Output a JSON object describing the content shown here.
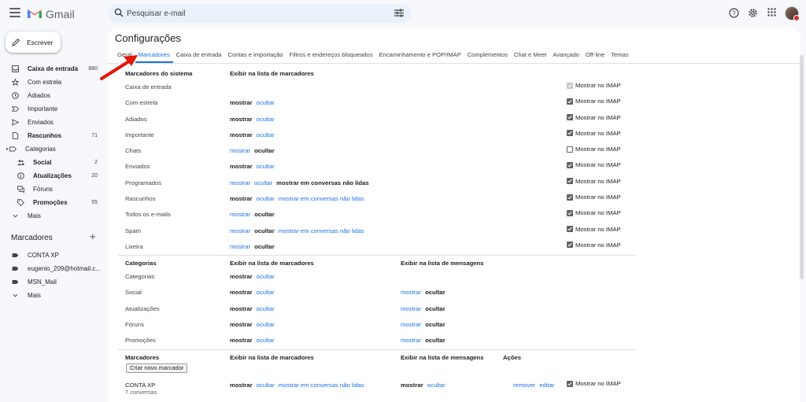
{
  "app": {
    "brand": "Gmail",
    "search_placeholder": "Pesquisar e-mail"
  },
  "compose": {
    "label": "Escrever"
  },
  "nav": {
    "items": [
      {
        "label": "Caixa de entrada",
        "count": "880",
        "bold": true,
        "icon": "inbox-icon"
      },
      {
        "label": "Com estrela",
        "count": "",
        "bold": false,
        "icon": "star-icon"
      },
      {
        "label": "Adiados",
        "count": "",
        "bold": false,
        "icon": "clock-icon"
      },
      {
        "label": "Importante",
        "count": "",
        "bold": false,
        "icon": "important-icon"
      },
      {
        "label": "Enviados",
        "count": "",
        "bold": false,
        "icon": "send-icon"
      },
      {
        "label": "Rascunhos",
        "count": "71",
        "bold": true,
        "icon": "draft-icon"
      },
      {
        "label": "Categorias",
        "count": "",
        "bold": false,
        "icon": "label-icon"
      },
      {
        "label": "Social",
        "count": "2",
        "bold": true,
        "icon": "people-icon"
      },
      {
        "label": "Atualizações",
        "count": "20",
        "bold": true,
        "icon": "info-icon"
      },
      {
        "label": "Fóruns",
        "count": "",
        "bold": false,
        "icon": "forum-icon"
      },
      {
        "label": "Promoções",
        "count": "55",
        "bold": true,
        "icon": "tag-icon"
      },
      {
        "label": "Mais",
        "count": "",
        "bold": false,
        "icon": "chevron-down-icon"
      }
    ],
    "labels_heading": "Marcadores",
    "labels": [
      "CONTA XP",
      "eugenio_209@hotmail.c...",
      "MSN_Mail",
      "Mais"
    ]
  },
  "settings": {
    "title": "Configurações",
    "tabs": [
      "Geral",
      "Marcadores",
      "Caixa de entrada",
      "Contas e importação",
      "Filtros e endereços bloqueados",
      "Encaminhamento e POP/IMAP",
      "Complementos",
      "Chat e Meet",
      "Avançado",
      "Off-line",
      "Temas"
    ],
    "active_tab": "Marcadores",
    "system": {
      "h1": "Marcadores do sistema",
      "h2": "Exibir na lista de marcadores",
      "rows": [
        {
          "name": "Caixa de entrada",
          "show": "",
          "hide": "",
          "unread": "",
          "active": "",
          "imap": "Mostrar no IMAP",
          "imap_state": "disabled"
        },
        {
          "name": "Com estrela",
          "show": "mostrar",
          "hide": "ocultar",
          "unread": "",
          "active": "show",
          "imap": "Mostrar no IMAP",
          "imap_state": "on"
        },
        {
          "name": "Adiados",
          "show": "mostrar",
          "hide": "ocultar",
          "unread": "",
          "active": "show",
          "imap": "Mostrar no IMAP",
          "imap_state": "on"
        },
        {
          "name": "Importante",
          "show": "mostrar",
          "hide": "ocultar",
          "unread": "",
          "active": "show",
          "imap": "Mostrar no IMAP",
          "imap_state": "on"
        },
        {
          "name": "Chats",
          "show": "mostrar",
          "hide": "ocultar",
          "unread": "",
          "active": "hide",
          "imap": "Mostrar no IMAP",
          "imap_state": "off"
        },
        {
          "name": "Enviados",
          "show": "mostrar",
          "hide": "ocultar",
          "unread": "",
          "active": "show",
          "imap": "Mostrar no IMAP",
          "imap_state": "on"
        },
        {
          "name": "Programados",
          "show": "mostrar",
          "hide": "ocultar",
          "unread": "mostrar em conversas não lidas",
          "active": "unread",
          "imap": "Mostrar no IMAP",
          "imap_state": "on"
        },
        {
          "name": "Rascunhos",
          "show": "mostrar",
          "hide": "ocultar",
          "unread": "mostrar em conversas não lidas",
          "active": "show",
          "imap": "Mostrar no IMAP",
          "imap_state": "on"
        },
        {
          "name": "Todos os e-mails",
          "show": "mostrar",
          "hide": "ocultar",
          "unread": "",
          "active": "hide",
          "imap": "Mostrar no IMAP",
          "imap_state": "on"
        },
        {
          "name": "Spam",
          "show": "mostrar",
          "hide": "ocultar",
          "unread": "mostrar em conversas não lidas",
          "active": "hide",
          "imap": "Mostrar no IMAP",
          "imap_state": "on"
        },
        {
          "name": "Lixeira",
          "show": "mostrar",
          "hide": "ocultar",
          "unread": "",
          "active": "hide",
          "imap": "Mostrar no IMAP",
          "imap_state": "on"
        }
      ]
    },
    "categories": {
      "h1": "Categorias",
      "h2": "Exibir na lista de marcadores",
      "h3": "Exibir na lista de mensagens",
      "rows": [
        {
          "name": "Categorias",
          "show": "mostrar",
          "hide": "ocultar",
          "active": "show",
          "m_show": "",
          "m_hide": "",
          "m_active": ""
        },
        {
          "name": "Social",
          "show": "mostrar",
          "hide": "ocultar",
          "active": "show",
          "m_show": "mostrar",
          "m_hide": "ocultar",
          "m_active": "hide"
        },
        {
          "name": "Atualizações",
          "show": "mostrar",
          "hide": "ocultar",
          "active": "show",
          "m_show": "mostrar",
          "m_hide": "ocultar",
          "m_active": "hide"
        },
        {
          "name": "Fóruns",
          "show": "mostrar",
          "hide": "ocultar",
          "active": "show",
          "m_show": "mostrar",
          "m_hide": "ocultar",
          "m_active": "hide"
        },
        {
          "name": "Promoções",
          "show": "mostrar",
          "hide": "ocultar",
          "active": "show",
          "m_show": "mostrar",
          "m_hide": "ocultar",
          "m_active": "hide"
        }
      ]
    },
    "labels": {
      "h1": "Marcadores",
      "h2": "Exibir na lista de marcadores",
      "h3": "Exibir na lista de mensagens",
      "h4": "Ações",
      "create_button": "Criar novo marcador",
      "rows": [
        {
          "name": "CONTA XP",
          "sub": "7 conversas",
          "show": "mostrar",
          "hide": "ocultar",
          "unread": "mostrar em conversas não lidas",
          "m_show": "mostrar",
          "m_hide": "ocultar",
          "remove": "remover",
          "edit": "editar",
          "imap": "Mostrar no IMAP"
        }
      ]
    }
  }
}
